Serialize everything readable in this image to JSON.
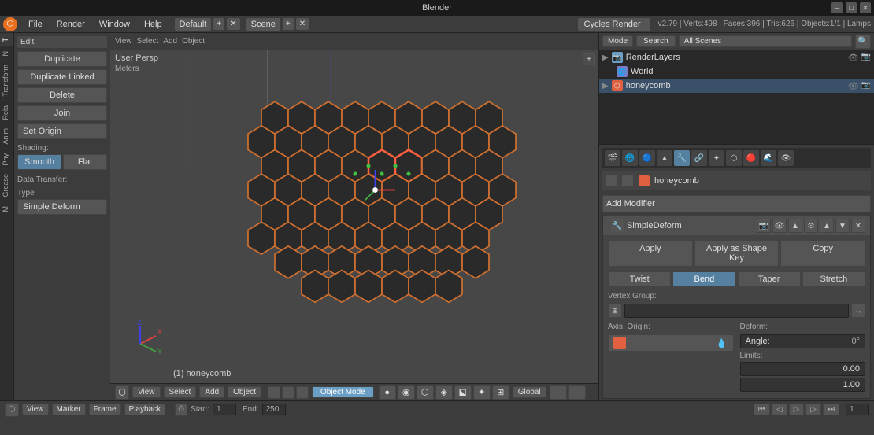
{
  "titlebar": {
    "title": "Blender",
    "minimize": "─",
    "maximize": "□",
    "close": "✕"
  },
  "menubar": {
    "items": [
      "File",
      "Render",
      "Window",
      "Help"
    ],
    "workspace": "Default",
    "scene": "Scene",
    "engine": "Cycles Render",
    "info": "v2.79 | Verts:498 | Faces:396 | Tris:626 | Objects:1/1 | Lamps"
  },
  "left_panel": {
    "tabs": [
      "T",
      "N"
    ],
    "side_tabs": [
      "Transform",
      "Rela",
      "Anim",
      "Phy",
      "Grease"
    ],
    "edit_label": "Edit",
    "duplicate_btn": "Duplicate",
    "duplicate_linked_btn": "Duplicate Linked",
    "delete_btn": "Delete",
    "join_btn": "Join",
    "set_origin_btn": "Set Origin",
    "shading_label": "Shading:",
    "smooth_btn": "Smooth",
    "flat_btn": "Flat",
    "data_transfer_label": "Data Transfer:",
    "type_label": "Type",
    "simple_deform_btn": "Simple Deform"
  },
  "viewport": {
    "view": "User Persp",
    "units": "Meters",
    "object_label": "(1) honeycomb",
    "mode_btn": "Object Mode",
    "global_btn": "Global",
    "view_menu": "View",
    "select_menu": "Select",
    "add_menu": "Add",
    "object_menu": "Object"
  },
  "right_panel": {
    "header": {
      "view_btn": "Mode",
      "search_btn": "Search",
      "all_scenes": "All Scenes",
      "search_icon": "🔍"
    },
    "outliner": {
      "items": [
        {
          "name": "RenderLayers",
          "indent": 0,
          "icon": "RL",
          "icon_class": "icon-camera",
          "visible": true
        },
        {
          "name": "World",
          "indent": 0,
          "icon": "W",
          "icon_class": "icon-world",
          "visible": true
        },
        {
          "name": "honeycomb",
          "indent": 0,
          "icon": "M",
          "icon_class": "icon-mesh",
          "visible": true,
          "selected": true
        }
      ]
    },
    "props_tabs": [
      "🎬",
      "📷",
      "🔵",
      "▲",
      "🔧",
      "🔗",
      "✦",
      "⬡",
      "🔴",
      "🌊",
      "👁"
    ],
    "object_name": "honeycomb",
    "add_modifier_label": "Add Modifier",
    "modifier": {
      "name": "SimpleDeform",
      "apply_btn": "Apply",
      "apply_shape_btn": "Apply as Shape Key",
      "copy_btn": "Copy",
      "modes": [
        "Twist",
        "Bend",
        "Taper",
        "Stretch"
      ],
      "active_mode": "Bend",
      "vertex_group_label": "Vertex Group:",
      "axis_origin_label": "Axis, Origin:",
      "deform_label": "Deform:",
      "angle_label": "Angle:",
      "angle_value": "0°",
      "limits_label": "Limits:",
      "limit_min": "0.00",
      "limit_max": "1.00"
    }
  },
  "bottom_bar": {
    "view_btn": "View",
    "marker_btn": "Marker",
    "frame_btn": "Frame",
    "playback_btn": "Playback",
    "start_label": "Start:",
    "start_val": "1",
    "end_label": "End:",
    "end_val": "250",
    "current_frame": "1"
  }
}
